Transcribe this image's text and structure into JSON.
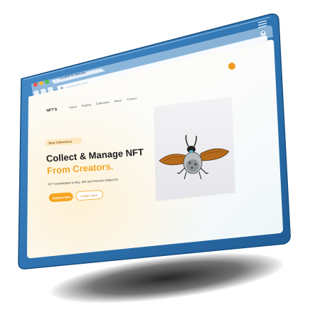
{
  "browser": {
    "tab_label": "CoolNFTs Website",
    "address": "yourdomain.com"
  },
  "site": {
    "logo": "NFT’S",
    "nav": [
      "Home",
      "Explore",
      "Collections",
      "About",
      "Contact"
    ],
    "badge": "Best Collections",
    "headline_line1": "Collect & Manage NFT",
    "headline_line2": "From Creators.",
    "subtext": "NFT marketplace to Buy, Sell and Discover Digital Art",
    "primary_button": "Explore Now",
    "secondary_button": "Create Yours"
  },
  "colors": {
    "frame": "#2f74b0",
    "accent": "#f5a623",
    "dot_orange": "#f29b21"
  }
}
